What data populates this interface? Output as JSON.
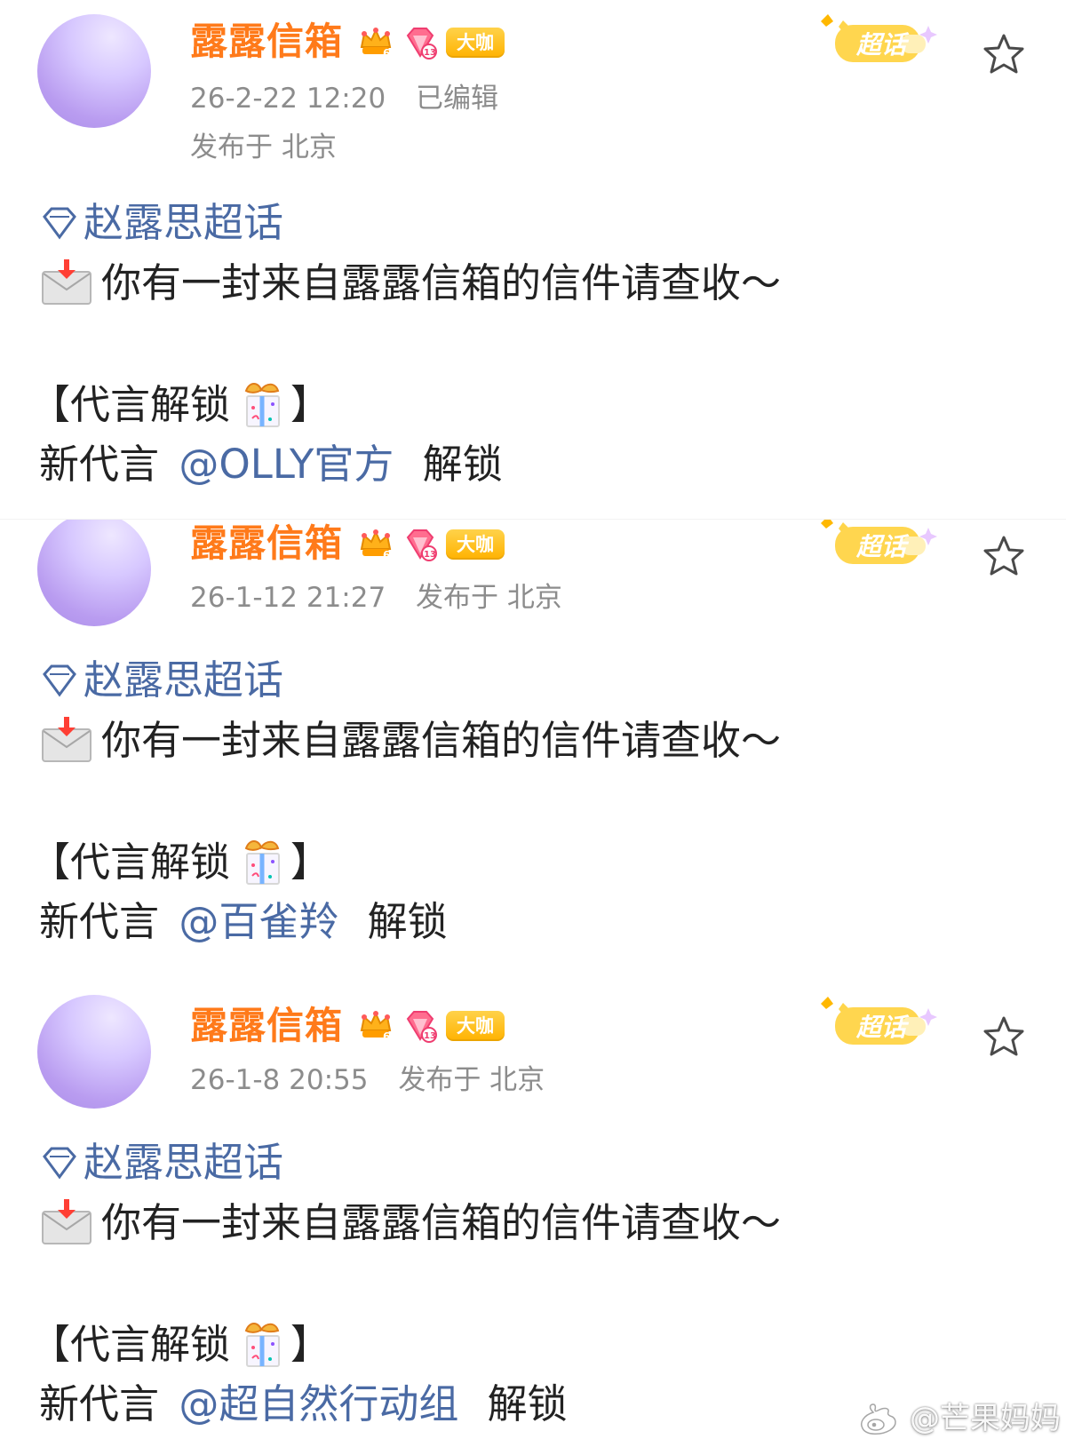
{
  "colors": {
    "username": "#ff7a1a",
    "link": "#4a6aa4",
    "meta": "#8c8c8c",
    "text": "#222222",
    "badge": "#ffb200"
  },
  "posts": [
    {
      "user": {
        "name": "露露信箱",
        "crown_level": "6",
        "gem_level": "13",
        "badge": "大咖"
      },
      "meta": {
        "time": "26-2-22 12:20",
        "edited": "已编辑",
        "location": "发布于 北京"
      },
      "actions": {
        "super_topic": "超话",
        "favorite_icon": "star-icon"
      },
      "topic": "赵露思超话",
      "message": "你有一封来自露露信箱的信件请查收～",
      "unlock_title_prefix": "【代言解锁",
      "unlock_title_suffix": "】",
      "unlock": {
        "prefix": "新代言",
        "mention": "@OLLY官方",
        "suffix": "解锁"
      }
    },
    {
      "user": {
        "name": "露露信箱",
        "crown_level": "6",
        "gem_level": "13",
        "badge": "大咖"
      },
      "meta": {
        "time": "26-1-12 21:27",
        "location": "发布于 北京"
      },
      "actions": {
        "super_topic": "超话",
        "favorite_icon": "star-icon"
      },
      "topic": "赵露思超话",
      "message": "你有一封来自露露信箱的信件请查收～",
      "unlock_title_prefix": "【代言解锁",
      "unlock_title_suffix": "】",
      "unlock": {
        "prefix": "新代言",
        "mention": "@百雀羚",
        "suffix": "解锁"
      }
    },
    {
      "user": {
        "name": "露露信箱",
        "crown_level": "6",
        "gem_level": "13",
        "badge": "大咖"
      },
      "meta": {
        "time": "26-1-8 20:55",
        "location": "发布于 北京"
      },
      "actions": {
        "super_topic": "超话",
        "favorite_icon": "star-icon"
      },
      "topic": "赵露思超话",
      "message": "你有一封来自露露信箱的信件请查收～",
      "unlock_title_prefix": "【代言解锁",
      "unlock_title_suffix": "】",
      "unlock": {
        "prefix": "新代言",
        "mention": "@超自然行动组",
        "suffix": "解锁"
      }
    }
  ],
  "watermark": "@芒果妈妈"
}
